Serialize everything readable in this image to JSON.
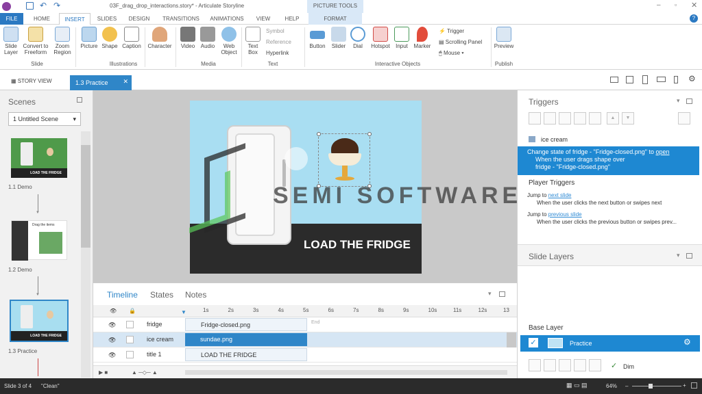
{
  "window": {
    "title": "03F_drag_drop_interactions.story* - Articulate Storyline",
    "context_tab": "PICTURE TOOLS"
  },
  "ribbon_tabs": [
    "FILE",
    "HOME",
    "INSERT",
    "SLIDES",
    "DESIGN",
    "TRANSITIONS",
    "ANIMATIONS",
    "VIEW",
    "HELP",
    "FORMAT"
  ],
  "ribbon": {
    "slide_layer": "Slide Layer",
    "convert": "Convert to Freeform",
    "zoom": "Zoom Region",
    "picture": "Picture",
    "shape": "Shape",
    "caption": "Caption",
    "character": "Character",
    "video": "Video",
    "audio": "Audio",
    "web": "Web Object",
    "textbox": "Text Box",
    "symbol": "Symbol",
    "reference": "Reference",
    "hyperlink": "Hyperlink",
    "button": "Button",
    "slider": "Slider",
    "dial": "Dial",
    "hotspot": "Hotspot",
    "input": "Input",
    "marker": "Marker",
    "trigger": "Trigger",
    "scrolling": "Scrolling Panel",
    "mouse": "Mouse",
    "preview": "Preview",
    "groups": {
      "slide": "Slide",
      "illustrations": "Illustrations",
      "media": "Media",
      "text": "Text",
      "interactive": "Interactive Objects",
      "publish": "Publish"
    }
  },
  "tabs": {
    "story_view": "STORY VIEW",
    "current": "1.3 Practice"
  },
  "scenes": {
    "title": "Scenes",
    "selector": "1 Untitled Scene",
    "slides": [
      {
        "label": "1.1 Demo",
        "caption": "LOAD THE FRIDGE"
      },
      {
        "label": "1.2 Demo",
        "caption": "Drag the items"
      },
      {
        "label": "1.3 Practice",
        "caption": "LOAD THE FRIDGE"
      }
    ]
  },
  "slide": {
    "heading": "LOAD THE FRIDGE",
    "watermark": "SEMI SOFTWARES"
  },
  "timeline": {
    "tabs": [
      "Timeline",
      "States",
      "Notes"
    ],
    "ticks": [
      "1s",
      "2s",
      "3s",
      "4s",
      "5s",
      "6s",
      "7s",
      "8s",
      "9s",
      "10s",
      "11s",
      "12s",
      "13"
    ],
    "end_label": "End",
    "rows": [
      {
        "name": "fridge",
        "item": "Fridge-closed.png"
      },
      {
        "name": "ice cream",
        "item": "sundae.png"
      },
      {
        "name": "title 1",
        "item": "LOAD THE FRIDGE"
      }
    ]
  },
  "triggers": {
    "title": "Triggers",
    "object": "ice cream",
    "t1_text": "Change state of fridge - \"Fridge-closed.png\" to ",
    "t1_link": "open",
    "t1_when": "When the user drags shape over",
    "t1_when2": "fridge - \"Fridge-closed.png\"",
    "player_title": "Player Triggers",
    "j1": "Jump to ",
    "j1_link": "next slide",
    "j1_when": "When the user clicks the next button or swipes next",
    "j2": "Jump to ",
    "j2_link": "previous slide",
    "j2_when": "When the user clicks the previous button or swipes prev..."
  },
  "layers": {
    "title": "Slide Layers",
    "base": "Base Layer",
    "practice": "Practice",
    "dim": "Dim"
  },
  "status": {
    "slide": "Slide 3 of 4",
    "theme": "\"Clean\"",
    "zoom": "64%"
  },
  "colors": {
    "accent": "#2f86c8",
    "select": "#1e88d2",
    "ribbon_file": "#2b79c2"
  }
}
